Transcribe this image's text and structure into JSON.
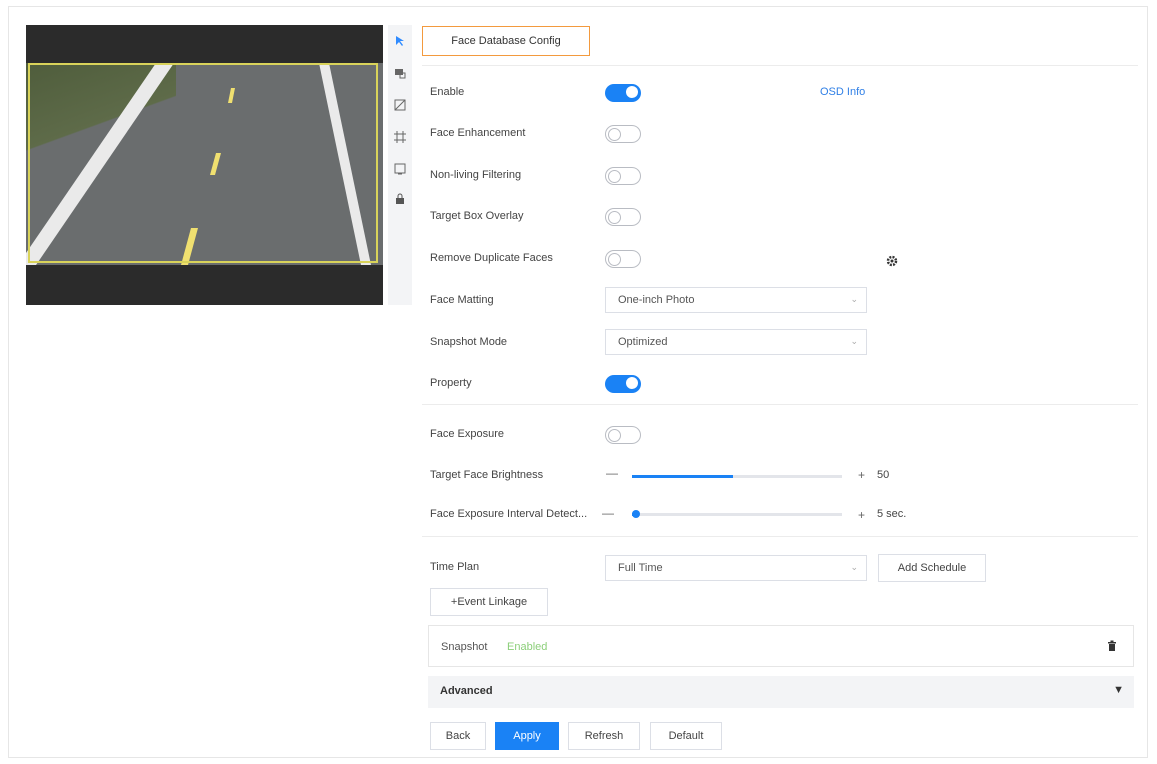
{
  "tab": {
    "label": "Face Database Config"
  },
  "settings": {
    "enable": {
      "label": "Enable",
      "on": true
    },
    "osd_info_link": "OSD Info",
    "face_enhancement": {
      "label": "Face Enhancement",
      "on": false
    },
    "non_living_filtering": {
      "label": "Non-living Filtering",
      "on": false
    },
    "target_box_overlay": {
      "label": "Target Box Overlay",
      "on": false
    },
    "remove_duplicate_faces": {
      "label": "Remove Duplicate Faces",
      "on": false
    },
    "face_matting": {
      "label": "Face Matting",
      "value": "One-inch Photo"
    },
    "snapshot_mode": {
      "label": "Snapshot Mode",
      "value": "Optimized"
    },
    "property": {
      "label": "Property",
      "on": true
    }
  },
  "exposure": {
    "face_exposure": {
      "label": "Face Exposure",
      "on": false
    },
    "target_brightness": {
      "label": "Target Face Brightness",
      "value": "50",
      "level": 0.48
    },
    "interval_detect": {
      "label": "Face Exposure Interval Detect...",
      "value": "5 sec.",
      "level": 0.02
    }
  },
  "schedule": {
    "time_plan_label": "Time Plan",
    "time_plan_value": "Full Time",
    "add_schedule": "Add Schedule",
    "event_linkage": "+Event Linkage"
  },
  "snapshot_panel": {
    "label": "Snapshot",
    "status": "Enabled"
  },
  "advanced_label": "Advanced",
  "footer": {
    "back": "Back",
    "apply": "Apply",
    "refresh": "Refresh",
    "default": "Default"
  },
  "colors": {
    "accent": "#1a82f5",
    "tab_border": "#f39a3e",
    "detect_box": "#d9d35a"
  },
  "icons": [
    "cursor-icon",
    "draw-rule-icon",
    "polygon-icon",
    "area-icon",
    "box-icon",
    "lock-icon",
    "gear-icon",
    "trash-icon",
    "chevron-down-icon"
  ]
}
